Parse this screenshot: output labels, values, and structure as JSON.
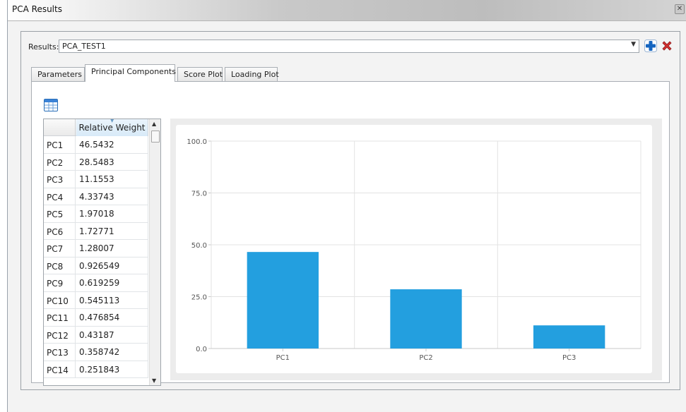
{
  "window": {
    "title": "PCA Results",
    "close_icon": "close-icon"
  },
  "results": {
    "label": "Results:",
    "value": "PCA_TEST1",
    "dropdown_icon": "chevron-down-icon",
    "add_icon": "plus-icon",
    "delete_icon": "delete-x-icon"
  },
  "tabs": [
    {
      "label": "Parameters",
      "active": false
    },
    {
      "label": "Principal Components",
      "active": true
    },
    {
      "label": "Score Plot",
      "active": false
    },
    {
      "label": "Loading Plot",
      "active": false
    }
  ],
  "toolbar": {
    "table_icon": "table-grid-icon"
  },
  "table": {
    "column_header": "Relative Weight",
    "rows": [
      {
        "pc": "PC1",
        "value": "46.5432"
      },
      {
        "pc": "PC2",
        "value": "28.5483"
      },
      {
        "pc": "PC3",
        "value": "11.1553"
      },
      {
        "pc": "PC4",
        "value": "4.33743"
      },
      {
        "pc": "PC5",
        "value": "1.97018"
      },
      {
        "pc": "PC6",
        "value": "1.72771"
      },
      {
        "pc": "PC7",
        "value": "1.28007"
      },
      {
        "pc": "PC8",
        "value": "0.926549"
      },
      {
        "pc": "PC9",
        "value": "0.619259"
      },
      {
        "pc": "PC10",
        "value": "0.545113"
      },
      {
        "pc": "PC11",
        "value": "0.476854"
      },
      {
        "pc": "PC12",
        "value": "0.43187"
      },
      {
        "pc": "PC13",
        "value": "0.358742"
      },
      {
        "pc": "PC14",
        "value": "0.251843"
      }
    ]
  },
  "colors": {
    "bar": "#239fdf",
    "grid": "#e3e3e3",
    "accent_blue": "#1565c0",
    "delete_red": "#d32f2f"
  },
  "chart_data": {
    "type": "bar",
    "categories": [
      "PC1",
      "PC2",
      "PC3"
    ],
    "values": [
      46.5432,
      28.5483,
      11.1553
    ],
    "yticks": [
      "0.0",
      "25.0",
      "50.0",
      "75.0",
      "100.0"
    ],
    "ylim": [
      0,
      100
    ],
    "grid": true,
    "title": "",
    "xlabel": "",
    "ylabel": ""
  }
}
